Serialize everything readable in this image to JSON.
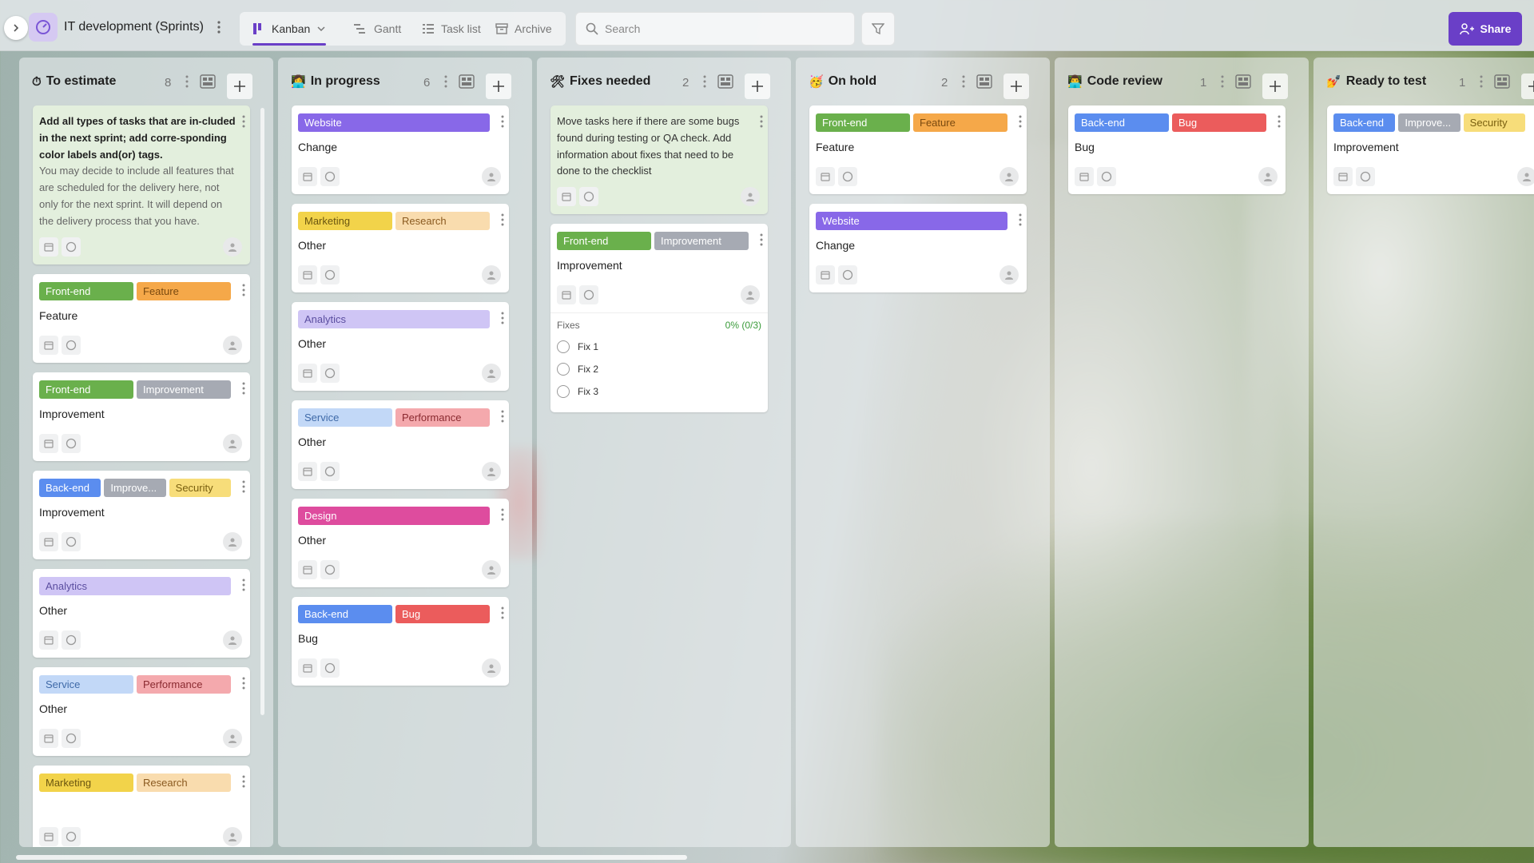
{
  "colors": {
    "accent": "#6a3fc7",
    "tag_frontend": "#6ab04c",
    "tag_feature": "#f5a849",
    "tag_improvement": "#a6aab3",
    "tag_backend": "#5b8def",
    "tag_security": "#f7dd7a",
    "tag_analytics": "#cfc5f5",
    "tag_service": "#c2d8f7",
    "tag_performance": "#f4a9ad",
    "tag_marketing": "#f2d34a",
    "tag_research": "#f9dcae",
    "tag_website": "#8868e8",
    "tag_design": "#de4c9e",
    "tag_bug": "#eb5c5c"
  },
  "header": {
    "project_title": "IT development (Sprints)",
    "views": [
      {
        "label": "Kanban",
        "icon": "kanban-icon",
        "active": true
      },
      {
        "label": "Gantt",
        "icon": "gantt-icon",
        "active": false
      },
      {
        "label": "Task list",
        "icon": "list-icon",
        "active": false
      },
      {
        "label": "Archive",
        "icon": "archive-icon",
        "active": false
      }
    ],
    "search_placeholder": "Search",
    "share_label": "Share"
  },
  "columns": [
    {
      "title": "To estimate",
      "emoji": "⏱",
      "count": "8",
      "cards": [
        {
          "type": "note",
          "bold": "Add all types of tasks that are in-cluded in the next sprint; add corre-sponding color labels and(or) tags.",
          "muted": "You may decide to include all features that are scheduled for the delivery here, not only for the next sprint. It will depend on the delivery process that you have."
        },
        {
          "tags": [
            {
              "label": "Front-end",
              "bg": "#6ab04c",
              "fg": "#ffffff"
            },
            {
              "label": "Feature",
              "bg": "#f5a849",
              "fg": "#7a4a10"
            }
          ],
          "title": "Feature"
        },
        {
          "tags": [
            {
              "label": "Front-end",
              "bg": "#6ab04c",
              "fg": "#ffffff"
            },
            {
              "label": "Improvement",
              "bg": "#a6aab3",
              "fg": "#ffffff"
            }
          ],
          "title": "Improvement"
        },
        {
          "tags": [
            {
              "label": "Back-end",
              "bg": "#5b8def",
              "fg": "#ffffff"
            },
            {
              "label": "Improve...",
              "bg": "#a6aab3",
              "fg": "#ffffff"
            },
            {
              "label": "Security",
              "bg": "#f7dd7a",
              "fg": "#7a6010"
            }
          ],
          "title": "Improvement"
        },
        {
          "tags": [
            {
              "label": "Analytics",
              "bg": "#cfc5f5",
              "fg": "#5b4ea0"
            }
          ],
          "title": "Other"
        },
        {
          "tags": [
            {
              "label": "Service",
              "bg": "#c2d8f7",
              "fg": "#3f6aa8"
            },
            {
              "label": "Performance",
              "bg": "#f4a9ad",
              "fg": "#8a2a30"
            }
          ],
          "title": "Other"
        },
        {
          "tags": [
            {
              "label": "Marketing",
              "bg": "#f2d34a",
              "fg": "#6a5510"
            },
            {
              "label": "Research",
              "bg": "#f9dcae",
              "fg": "#8a5a20"
            }
          ],
          "title": ""
        }
      ]
    },
    {
      "title": "In progress",
      "emoji": "👩‍💻",
      "count": "6",
      "cards": [
        {
          "tags": [
            {
              "label": "Website",
              "bg": "#8868e8",
              "fg": "#ffffff"
            }
          ],
          "title": "Change"
        },
        {
          "tags": [
            {
              "label": "Marketing",
              "bg": "#f2d34a",
              "fg": "#6a5510"
            },
            {
              "label": "Research",
              "bg": "#f9dcae",
              "fg": "#8a5a20"
            }
          ],
          "title": "Other"
        },
        {
          "tags": [
            {
              "label": "Analytics",
              "bg": "#cfc5f5",
              "fg": "#5b4ea0"
            }
          ],
          "title": "Other"
        },
        {
          "tags": [
            {
              "label": "Service",
              "bg": "#c2d8f7",
              "fg": "#3f6aa8"
            },
            {
              "label": "Performance",
              "bg": "#f4a9ad",
              "fg": "#8a2a30"
            }
          ],
          "title": "Other"
        },
        {
          "tags": [
            {
              "label": "Design",
              "bg": "#de4c9e",
              "fg": "#ffffff"
            }
          ],
          "title": "Other"
        },
        {
          "tags": [
            {
              "label": "Back-end",
              "bg": "#5b8def",
              "fg": "#ffffff"
            },
            {
              "label": "Bug",
              "bg": "#eb5c5c",
              "fg": "#ffffff"
            }
          ],
          "title": "Bug"
        }
      ]
    },
    {
      "title": "Fixes needed",
      "emoji": "🛠",
      "count": "2",
      "cards": [
        {
          "type": "note",
          "bold": "",
          "plain": "Move tasks here if there are some bugs found during testing or QA check. Add information about fixes that need to be done to the checklist"
        },
        {
          "tags": [
            {
              "label": "Front-end",
              "bg": "#6ab04c",
              "fg": "#ffffff"
            },
            {
              "label": "Improvement",
              "bg": "#a6aab3",
              "fg": "#ffffff"
            }
          ],
          "title": "Improvement",
          "checklist": {
            "title": "Fixes",
            "progress": "0% (0/3)",
            "items": [
              "Fix 1",
              "Fix 2",
              "Fix 3"
            ]
          }
        }
      ]
    },
    {
      "title": "On hold",
      "emoji": "🥳",
      "count": "2",
      "cards": [
        {
          "tags": [
            {
              "label": "Front-end",
              "bg": "#6ab04c",
              "fg": "#ffffff"
            },
            {
              "label": "Feature",
              "bg": "#f5a849",
              "fg": "#7a4a10"
            }
          ],
          "title": "Feature"
        },
        {
          "tags": [
            {
              "label": "Website",
              "bg": "#8868e8",
              "fg": "#ffffff"
            }
          ],
          "title": "Change"
        }
      ]
    },
    {
      "title": "Code review",
      "emoji": "👨‍💻",
      "count": "1",
      "cards": [
        {
          "tags": [
            {
              "label": "Back-end",
              "bg": "#5b8def",
              "fg": "#ffffff"
            },
            {
              "label": "Bug",
              "bg": "#eb5c5c",
              "fg": "#ffffff"
            }
          ],
          "title": "Bug"
        }
      ]
    },
    {
      "title": "Ready to test",
      "emoji": "💅",
      "count": "1",
      "cards": [
        {
          "tags": [
            {
              "label": "Back-end",
              "bg": "#5b8def",
              "fg": "#ffffff"
            },
            {
              "label": "Improve...",
              "bg": "#a6aab3",
              "fg": "#ffffff"
            },
            {
              "label": "Security",
              "bg": "#f7dd7a",
              "fg": "#7a6010"
            }
          ],
          "title": "Improvement"
        }
      ]
    }
  ]
}
